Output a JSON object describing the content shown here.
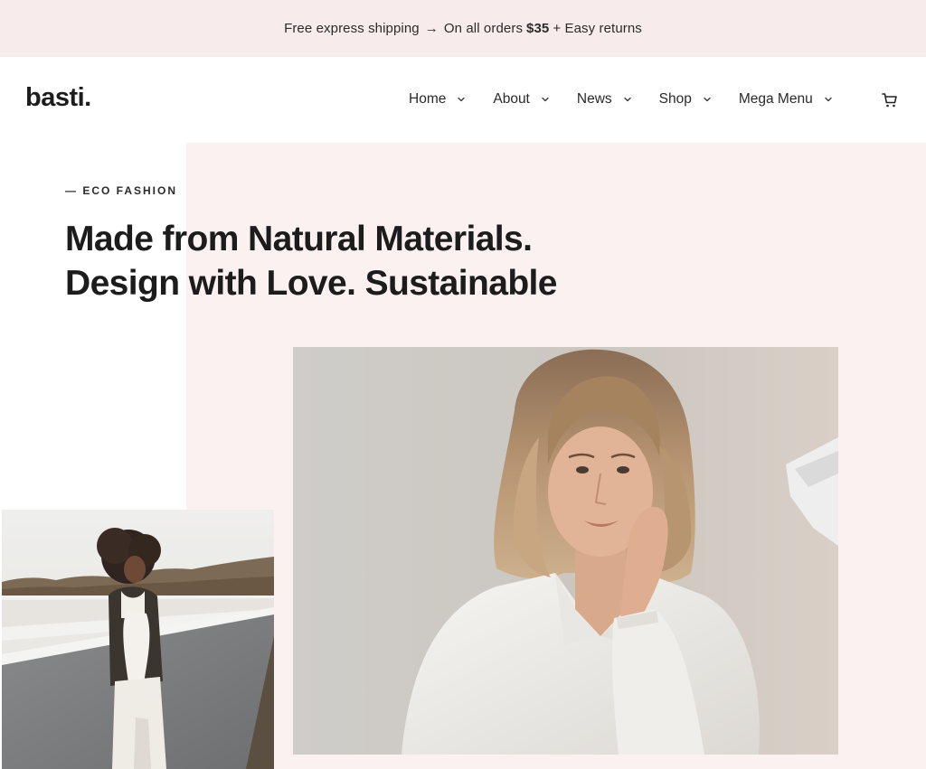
{
  "announcement": {
    "text_before": "Free express shipping",
    "arrow": "→",
    "text_middle": "On all orders",
    "amount": "$35",
    "text_after": "+ Easy returns"
  },
  "header": {
    "logo": "basti.",
    "nav": [
      {
        "label": "Home",
        "icon": "chevron-down-icon"
      },
      {
        "label": "About",
        "icon": "chevron-down-icon"
      },
      {
        "label": "News",
        "icon": "chevron-down-icon"
      },
      {
        "label": "Shop",
        "icon": "chevron-down-icon"
      },
      {
        "label": "Mega Menu",
        "icon": "chevron-down-icon"
      }
    ],
    "cart_icon": "cart-icon"
  },
  "hero": {
    "eyebrow": "— ECO FASHION",
    "headline_line1": "Made from Natural Materials.",
    "headline_line2": "Design with Love. Sustainable"
  },
  "colors": {
    "topbar_bg": "#f8ebeb",
    "panel_bg": "#fbf1f1",
    "text": "#1c1c1c"
  }
}
